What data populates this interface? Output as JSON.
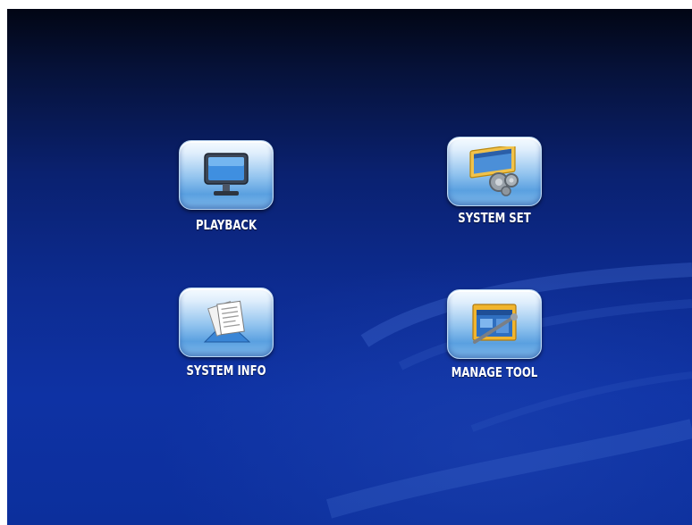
{
  "menu": {
    "items": [
      {
        "label": "PLAYBACK",
        "icon": "monitor-icon"
      },
      {
        "label": "SYSTEM SET",
        "icon": "settings-gears-icon"
      },
      {
        "label": "SYSTEM INFO",
        "icon": "documents-icon"
      },
      {
        "label": "MANAGE TOOL",
        "icon": "tools-window-icon"
      }
    ]
  },
  "colors": {
    "background_top": "#020614",
    "background_bottom": "#0e32a4",
    "button_light": "#f6fbff",
    "button_mid": "#8fc2ee",
    "label_text": "#ffffff"
  }
}
